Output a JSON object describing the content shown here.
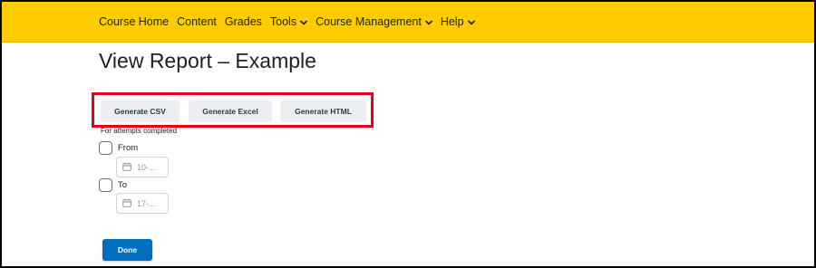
{
  "nav": {
    "items": [
      {
        "label": "Course Home",
        "has_menu": false
      },
      {
        "label": "Content",
        "has_menu": false
      },
      {
        "label": "Grades",
        "has_menu": false
      },
      {
        "label": "Tools",
        "has_menu": true
      },
      {
        "label": "Course Management",
        "has_menu": true
      },
      {
        "label": "Help",
        "has_menu": true
      }
    ],
    "bg_color": "#ffcc00"
  },
  "page": {
    "title": "View Report – Example"
  },
  "actions": {
    "csv_label": "Generate CSV",
    "excel_label": "Generate Excel",
    "html_label": "Generate HTML",
    "highlight_color": "#e3001b"
  },
  "filters": {
    "attempts_label": "For attempts completed",
    "from": {
      "label": "From",
      "checked": false,
      "date_value": "10-..."
    },
    "to": {
      "label": "To",
      "checked": false,
      "date_value": "17-..."
    }
  },
  "footer": {
    "done_label": "Done",
    "done_color": "#006fbf"
  }
}
